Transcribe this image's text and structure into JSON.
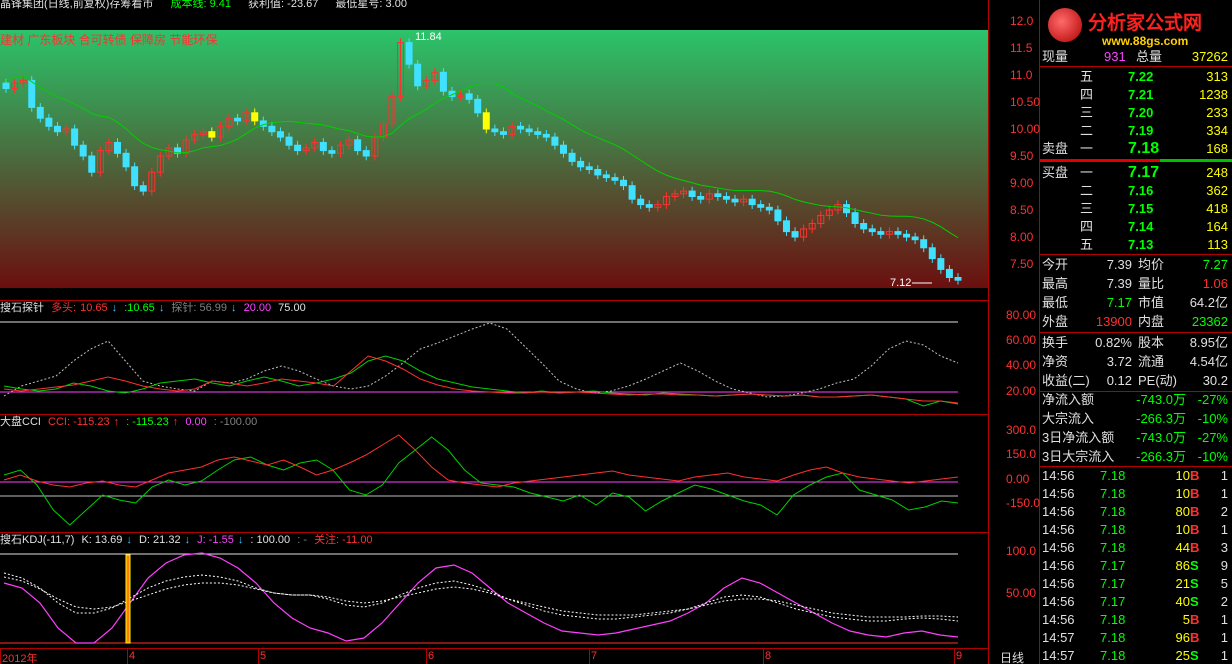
{
  "topbar": {
    "title": "晶锋集团(日线,前复权)存筹看市",
    "cost": "成本线: 9.41",
    "profit": "获利值: -23.67",
    "stars": "最低星号: 3.00"
  },
  "main_chart": {
    "sectors": "建材 广东板块 合可转债 保障房 节能环保",
    "high_label": "11.84",
    "low_label": "7.12",
    "y_ticks": [
      "12.0",
      "11.5",
      "11.0",
      "10.50",
      "10.00",
      "9.50",
      "9.00",
      "8.50",
      "8.00",
      "7.50"
    ],
    "ma_color": "#00d000",
    "gradient_top": "#2bc46a",
    "gradient_bottom": "#6b0f0f"
  },
  "panel1": {
    "name": "搜石探针",
    "duotou_label": "多头:",
    "duotou_val": "10.65",
    "v2": ":10.65",
    "probe_label": "探针: 56.99",
    "v3": "20.00",
    "v4": "75.00",
    "y_ticks": [
      "80.00",
      "60.00",
      "40.00",
      "20.00"
    ]
  },
  "panel2": {
    "name": "大盘CCI",
    "cci_label": "CCI: -115.23",
    "v2": ": -115.23",
    "v3": "0.00",
    "v4": ": -100.00",
    "y_ticks": [
      "300.0",
      "150.0",
      "0.00",
      "-150.0"
    ]
  },
  "panel3": {
    "name": "搜石KDJ(-11,7)",
    "k_label": "K: 13.69",
    "d_label": "D: 21.32",
    "j_label": "J: -1.55",
    "v4": ": 100.00",
    "v5": ": -",
    "attention": "关注: -11.00",
    "y_ticks": [
      "100.0",
      "50.00"
    ]
  },
  "xaxis": {
    "labels": [
      "2012年",
      "4",
      "5",
      "6",
      "7",
      "8",
      "9"
    ],
    "period": "日线"
  },
  "logo": {
    "name": "分析家公式网",
    "url": "www.88gs.com"
  },
  "quote": {
    "xianliang_label": "现量",
    "xianliang_val": "931",
    "zongliang_label": "总量",
    "zongliang_val": "37262",
    "sell_label": "卖盘",
    "buy_label": "买盘",
    "sells": [
      {
        "lvl": "五",
        "price": "7.22",
        "vol": "313"
      },
      {
        "lvl": "四",
        "price": "7.21",
        "vol": "1238"
      },
      {
        "lvl": "三",
        "price": "7.20",
        "vol": "233"
      },
      {
        "lvl": "二",
        "price": "7.19",
        "vol": "334"
      },
      {
        "lvl": "一",
        "price": "7.18",
        "vol": "168"
      }
    ],
    "buys": [
      {
        "lvl": "一",
        "price": "7.17",
        "vol": "248"
      },
      {
        "lvl": "二",
        "price": "7.16",
        "vol": "362"
      },
      {
        "lvl": "三",
        "price": "7.15",
        "vol": "418"
      },
      {
        "lvl": "四",
        "price": "7.14",
        "vol": "164"
      },
      {
        "lvl": "五",
        "price": "7.13",
        "vol": "113"
      }
    ],
    "stats": [
      {
        "l1": "今开",
        "v1": "7.39",
        "c1": "#e0e0e0",
        "l2": "均价",
        "v2": "7.27",
        "c2": "#00ff00"
      },
      {
        "l1": "最高",
        "v1": "7.39",
        "c1": "#e0e0e0",
        "l2": "量比",
        "v2": "1.06",
        "c2": "#ff3030"
      },
      {
        "l1": "最低",
        "v1": "7.17",
        "c1": "#00ff00",
        "l2": "市值",
        "v2": "64.2亿",
        "c2": "#e0e0e0"
      },
      {
        "l1": "外盘",
        "v1": "13900",
        "c1": "#ff3030",
        "l2": "内盘",
        "v2": "23362",
        "c2": "#00ff00"
      }
    ],
    "stats2": [
      {
        "l1": "换手",
        "v1": "0.82%",
        "l2": "股本",
        "v2": "8.95亿"
      },
      {
        "l1": "净资",
        "v1": "3.72",
        "l2": "流通",
        "v2": "4.54亿"
      },
      {
        "l1": "收益(二)",
        "v1": "0.12",
        "l2": "PE(动)",
        "v2": "30.2"
      }
    ],
    "flows": [
      {
        "label": "净流入额",
        "val": "-743.0万",
        "pct": "-27%"
      },
      {
        "label": "大宗流入",
        "val": "-266.3万",
        "pct": "-10%"
      },
      {
        "label": "3日净流入额",
        "val": "-743.0万",
        "pct": "-27%"
      },
      {
        "label": "3日大宗流入",
        "val": "-266.3万",
        "pct": "-10%"
      }
    ],
    "ticks": [
      {
        "time": "14:56",
        "price": "7.18",
        "vol": "10",
        "bs": "B",
        "n": "1"
      },
      {
        "time": "14:56",
        "price": "7.18",
        "vol": "10",
        "bs": "B",
        "n": "1"
      },
      {
        "time": "14:56",
        "price": "7.18",
        "vol": "80",
        "bs": "B",
        "n": "2"
      },
      {
        "time": "14:56",
        "price": "7.18",
        "vol": "10",
        "bs": "B",
        "n": "1"
      },
      {
        "time": "14:56",
        "price": "7.18",
        "vol": "44",
        "bs": "B",
        "n": "3"
      },
      {
        "time": "14:56",
        "price": "7.17",
        "vol": "86",
        "bs": "S",
        "n": "9"
      },
      {
        "time": "14:56",
        "price": "7.17",
        "vol": "21",
        "bs": "S",
        "n": "5"
      },
      {
        "time": "14:56",
        "price": "7.17",
        "vol": "40",
        "bs": "S",
        "n": "2"
      },
      {
        "time": "14:56",
        "price": "7.18",
        "vol": "5",
        "bs": "B",
        "n": "1"
      },
      {
        "time": "14:57",
        "price": "7.18",
        "vol": "96",
        "bs": "B",
        "n": "1"
      },
      {
        "time": "14:57",
        "price": "7.18",
        "vol": "25",
        "bs": "S",
        "n": "1"
      }
    ]
  }
}
